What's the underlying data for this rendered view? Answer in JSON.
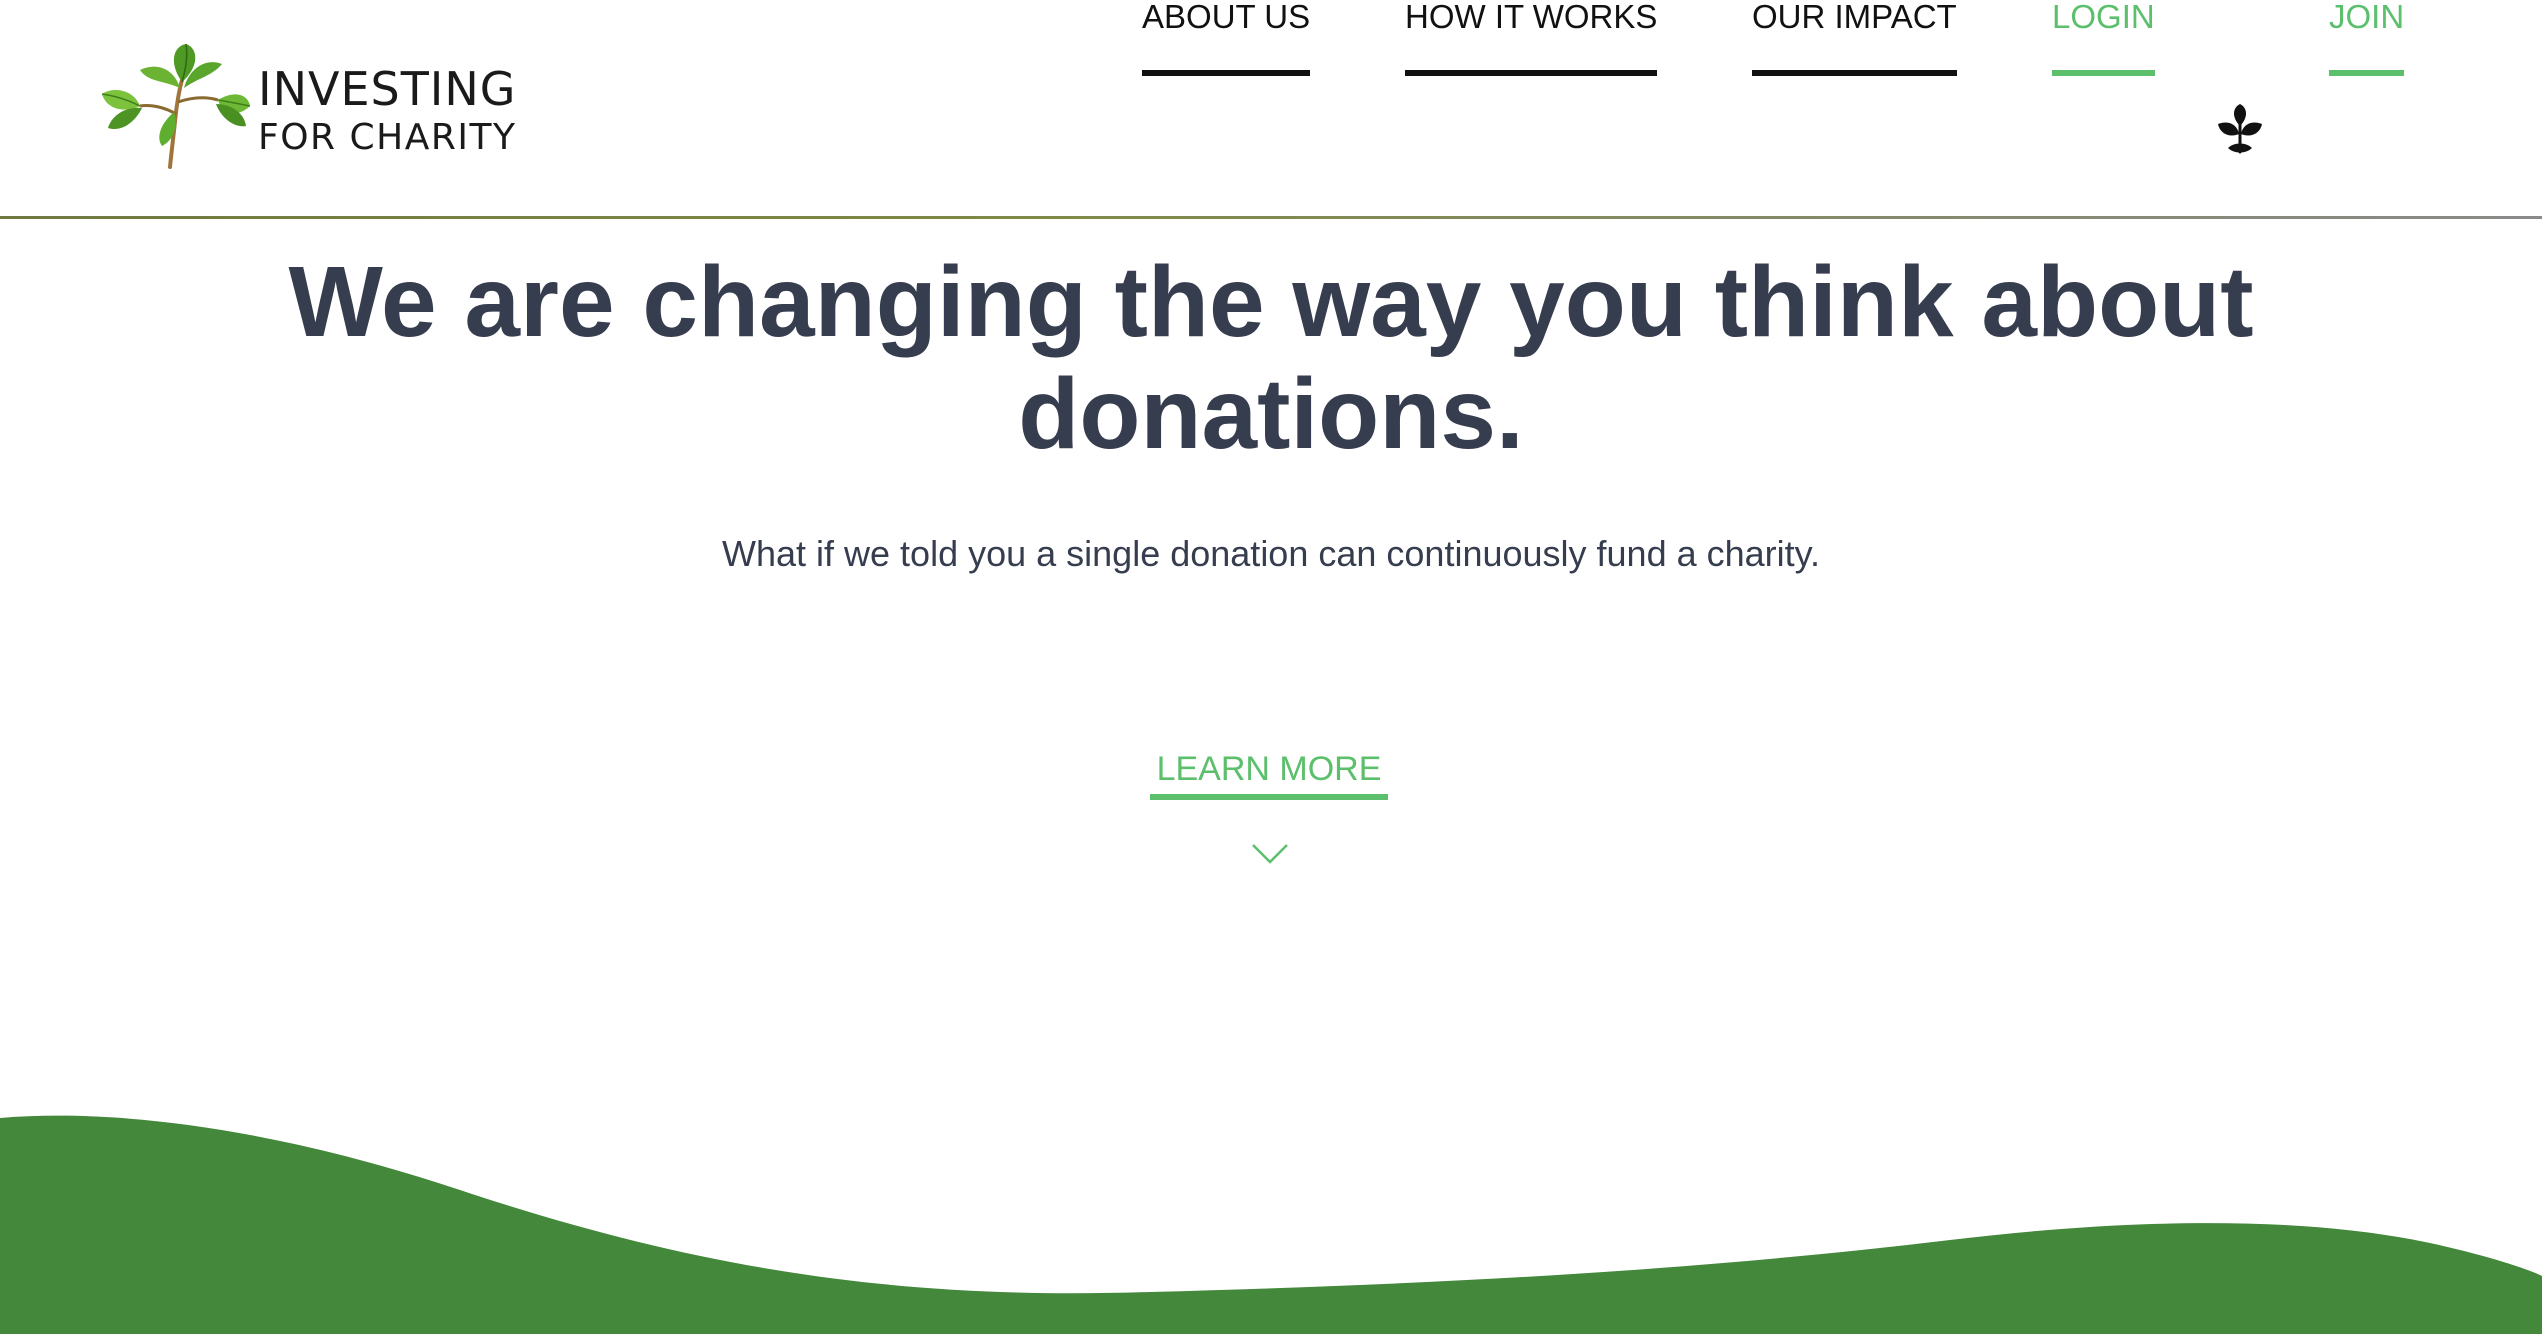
{
  "brand": {
    "line1": "INVESTING",
    "line2": "FOR CHARITY"
  },
  "nav": {
    "about": "ABOUT US",
    "how": "HOW IT WORKS",
    "impact": "OUR IMPACT",
    "login": "LOGIN",
    "join": "JOIN"
  },
  "hero": {
    "title": "We are changing the way you think about donations.",
    "subtitle": "What if we told you a single donation can continuously fund a charity.",
    "cta": "LEARN MORE"
  },
  "icons": {
    "logo": "leaf-sprig-icon",
    "nav_leaf": "leaf-icon",
    "scroll": "chevron-down-icon"
  },
  "colors": {
    "text_dark": "#363d4e",
    "accent_green": "#5cbf6c",
    "wave_green": "#43883b",
    "nav_text": "#111111"
  }
}
